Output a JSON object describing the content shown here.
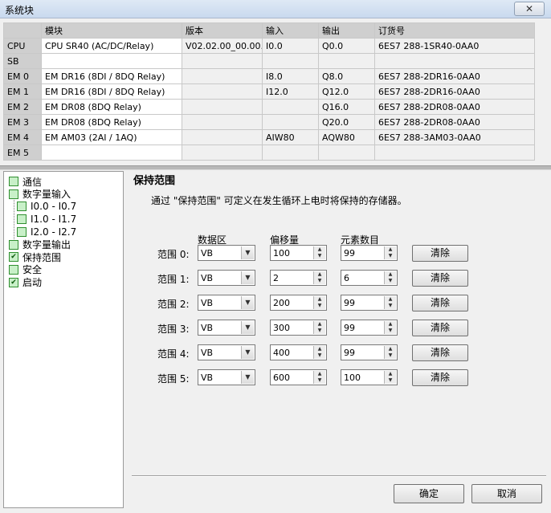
{
  "window": {
    "title": "系统块",
    "close_icon": "close-icon"
  },
  "modules": {
    "headers": [
      "",
      "模块",
      "版本",
      "输入",
      "输出",
      "订货号"
    ],
    "rows": [
      {
        "slot": "CPU",
        "module": "CPU SR40 (AC/DC/Relay)",
        "version": "V02.02.00_00.00...",
        "input": "I0.0",
        "output": "Q0.0",
        "order": "6ES7 288-1SR40-0AA0"
      },
      {
        "slot": "SB",
        "module": "",
        "version": "",
        "input": "",
        "output": "",
        "order": ""
      },
      {
        "slot": "EM 0",
        "module": "EM DR16 (8DI / 8DQ Relay)",
        "version": "",
        "input": "I8.0",
        "output": "Q8.0",
        "order": "6ES7 288-2DR16-0AA0"
      },
      {
        "slot": "EM 1",
        "module": "EM DR16 (8DI / 8DQ Relay)",
        "version": "",
        "input": "I12.0",
        "output": "Q12.0",
        "order": "6ES7 288-2DR16-0AA0"
      },
      {
        "slot": "EM 2",
        "module": "EM DR08 (8DQ Relay)",
        "version": "",
        "input": "",
        "output": "Q16.0",
        "order": "6ES7 288-2DR08-0AA0"
      },
      {
        "slot": "EM 3",
        "module": "EM DR08 (8DQ Relay)",
        "version": "",
        "input": "",
        "output": "Q20.0",
        "order": "6ES7 288-2DR08-0AA0"
      },
      {
        "slot": "EM 4",
        "module": "EM AM03 (2AI / 1AQ)",
        "version": "",
        "input": "AIW80",
        "output": "AQW80",
        "order": "6ES7 288-3AM03-0AA0"
      },
      {
        "slot": "EM 5",
        "module": "",
        "version": "",
        "input": "",
        "output": "",
        "order": ""
      }
    ]
  },
  "nav": {
    "items": [
      {
        "label": "通信",
        "checked": false,
        "child": false
      },
      {
        "label": "数字量输入",
        "checked": false,
        "child": false
      },
      {
        "label": "I0.0 - I0.7",
        "checked": false,
        "child": true
      },
      {
        "label": "I1.0 - I1.7",
        "checked": false,
        "child": true
      },
      {
        "label": "I2.0 - I2.7",
        "checked": false,
        "child": true
      },
      {
        "label": "数字量输出",
        "checked": false,
        "child": false
      },
      {
        "label": "保持范围",
        "checked": true,
        "child": false
      },
      {
        "label": "安全",
        "checked": false,
        "child": false
      },
      {
        "label": "启动",
        "checked": true,
        "child": false
      }
    ]
  },
  "panel": {
    "title": "保持范围",
    "description": "通过 \"保持范围\" 可定义在发生循环上电时将保持的存储器。",
    "col_area": "数据区",
    "col_offset": "偏移量",
    "col_count": "元素数目",
    "ranges": [
      {
        "label": "范围 0:",
        "area": "VB",
        "offset": "100",
        "count": "99",
        "clear": "清除"
      },
      {
        "label": "范围 1:",
        "area": "VB",
        "offset": "2",
        "count": "6",
        "clear": "清除"
      },
      {
        "label": "范围 2:",
        "area": "VB",
        "offset": "200",
        "count": "99",
        "clear": "清除"
      },
      {
        "label": "范围 3:",
        "area": "VB",
        "offset": "300",
        "count": "99",
        "clear": "清除"
      },
      {
        "label": "范围 4:",
        "area": "VB",
        "offset": "400",
        "count": "99",
        "clear": "清除"
      },
      {
        "label": "范围 5:",
        "area": "VB",
        "offset": "600",
        "count": "100",
        "clear": "清除"
      }
    ]
  },
  "footer": {
    "ok": "确定",
    "cancel": "取消"
  }
}
